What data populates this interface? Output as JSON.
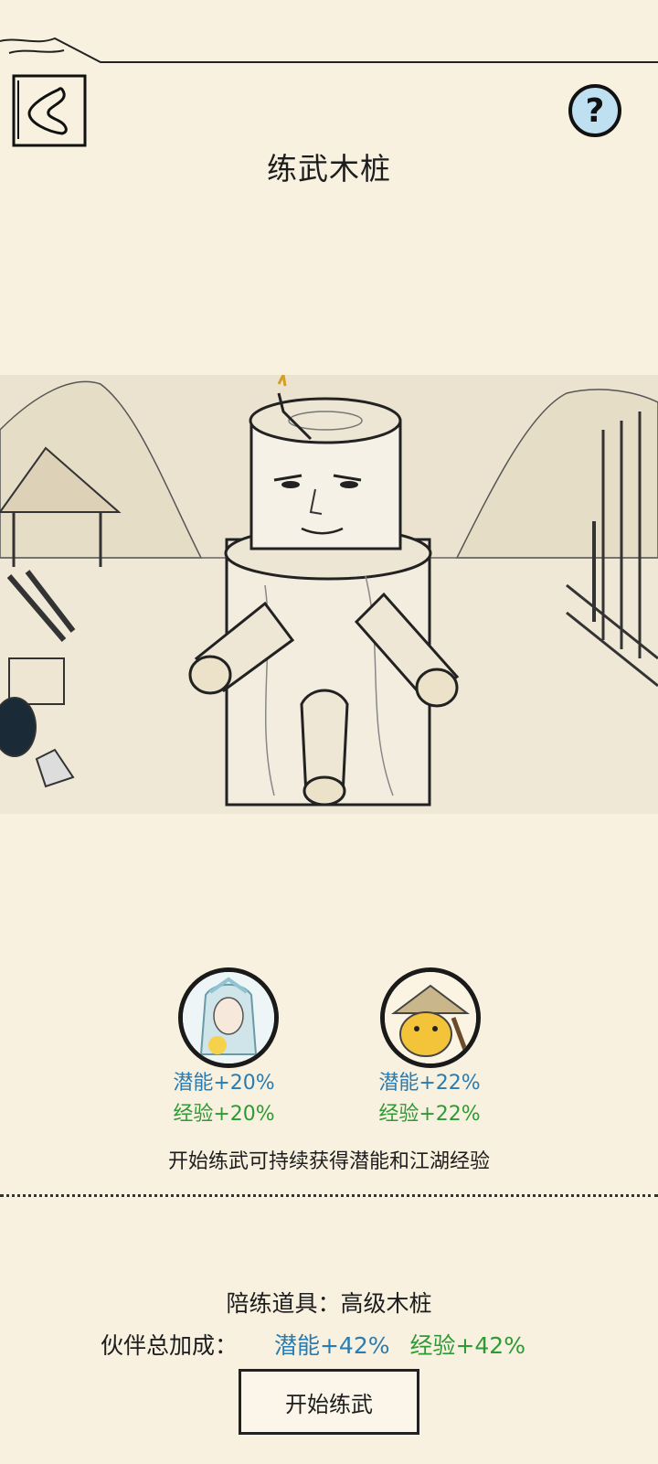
{
  "header": {
    "title": "练武木桩"
  },
  "partners": [
    {
      "potential": "潜能+20%",
      "experience": "经验+20%"
    },
    {
      "potential": "潜能+22%",
      "experience": "经验+22%"
    }
  ],
  "info_text": "开始练武可持续获得潜能和江湖经验",
  "equipment": {
    "label": "陪练道具：高级木桩"
  },
  "total": {
    "label": "伙伴总加成：",
    "potential": "潜能+42%",
    "experience": "经验+42%"
  },
  "start_button": {
    "label": "开始练武"
  },
  "colors": {
    "background": "#f8f1df",
    "potential": "#2a7bb0",
    "experience": "#2e9a35",
    "help_fill": "#bfe0f0"
  },
  "icons": {
    "back": "back-arrow-icon",
    "help": "question-icon"
  }
}
